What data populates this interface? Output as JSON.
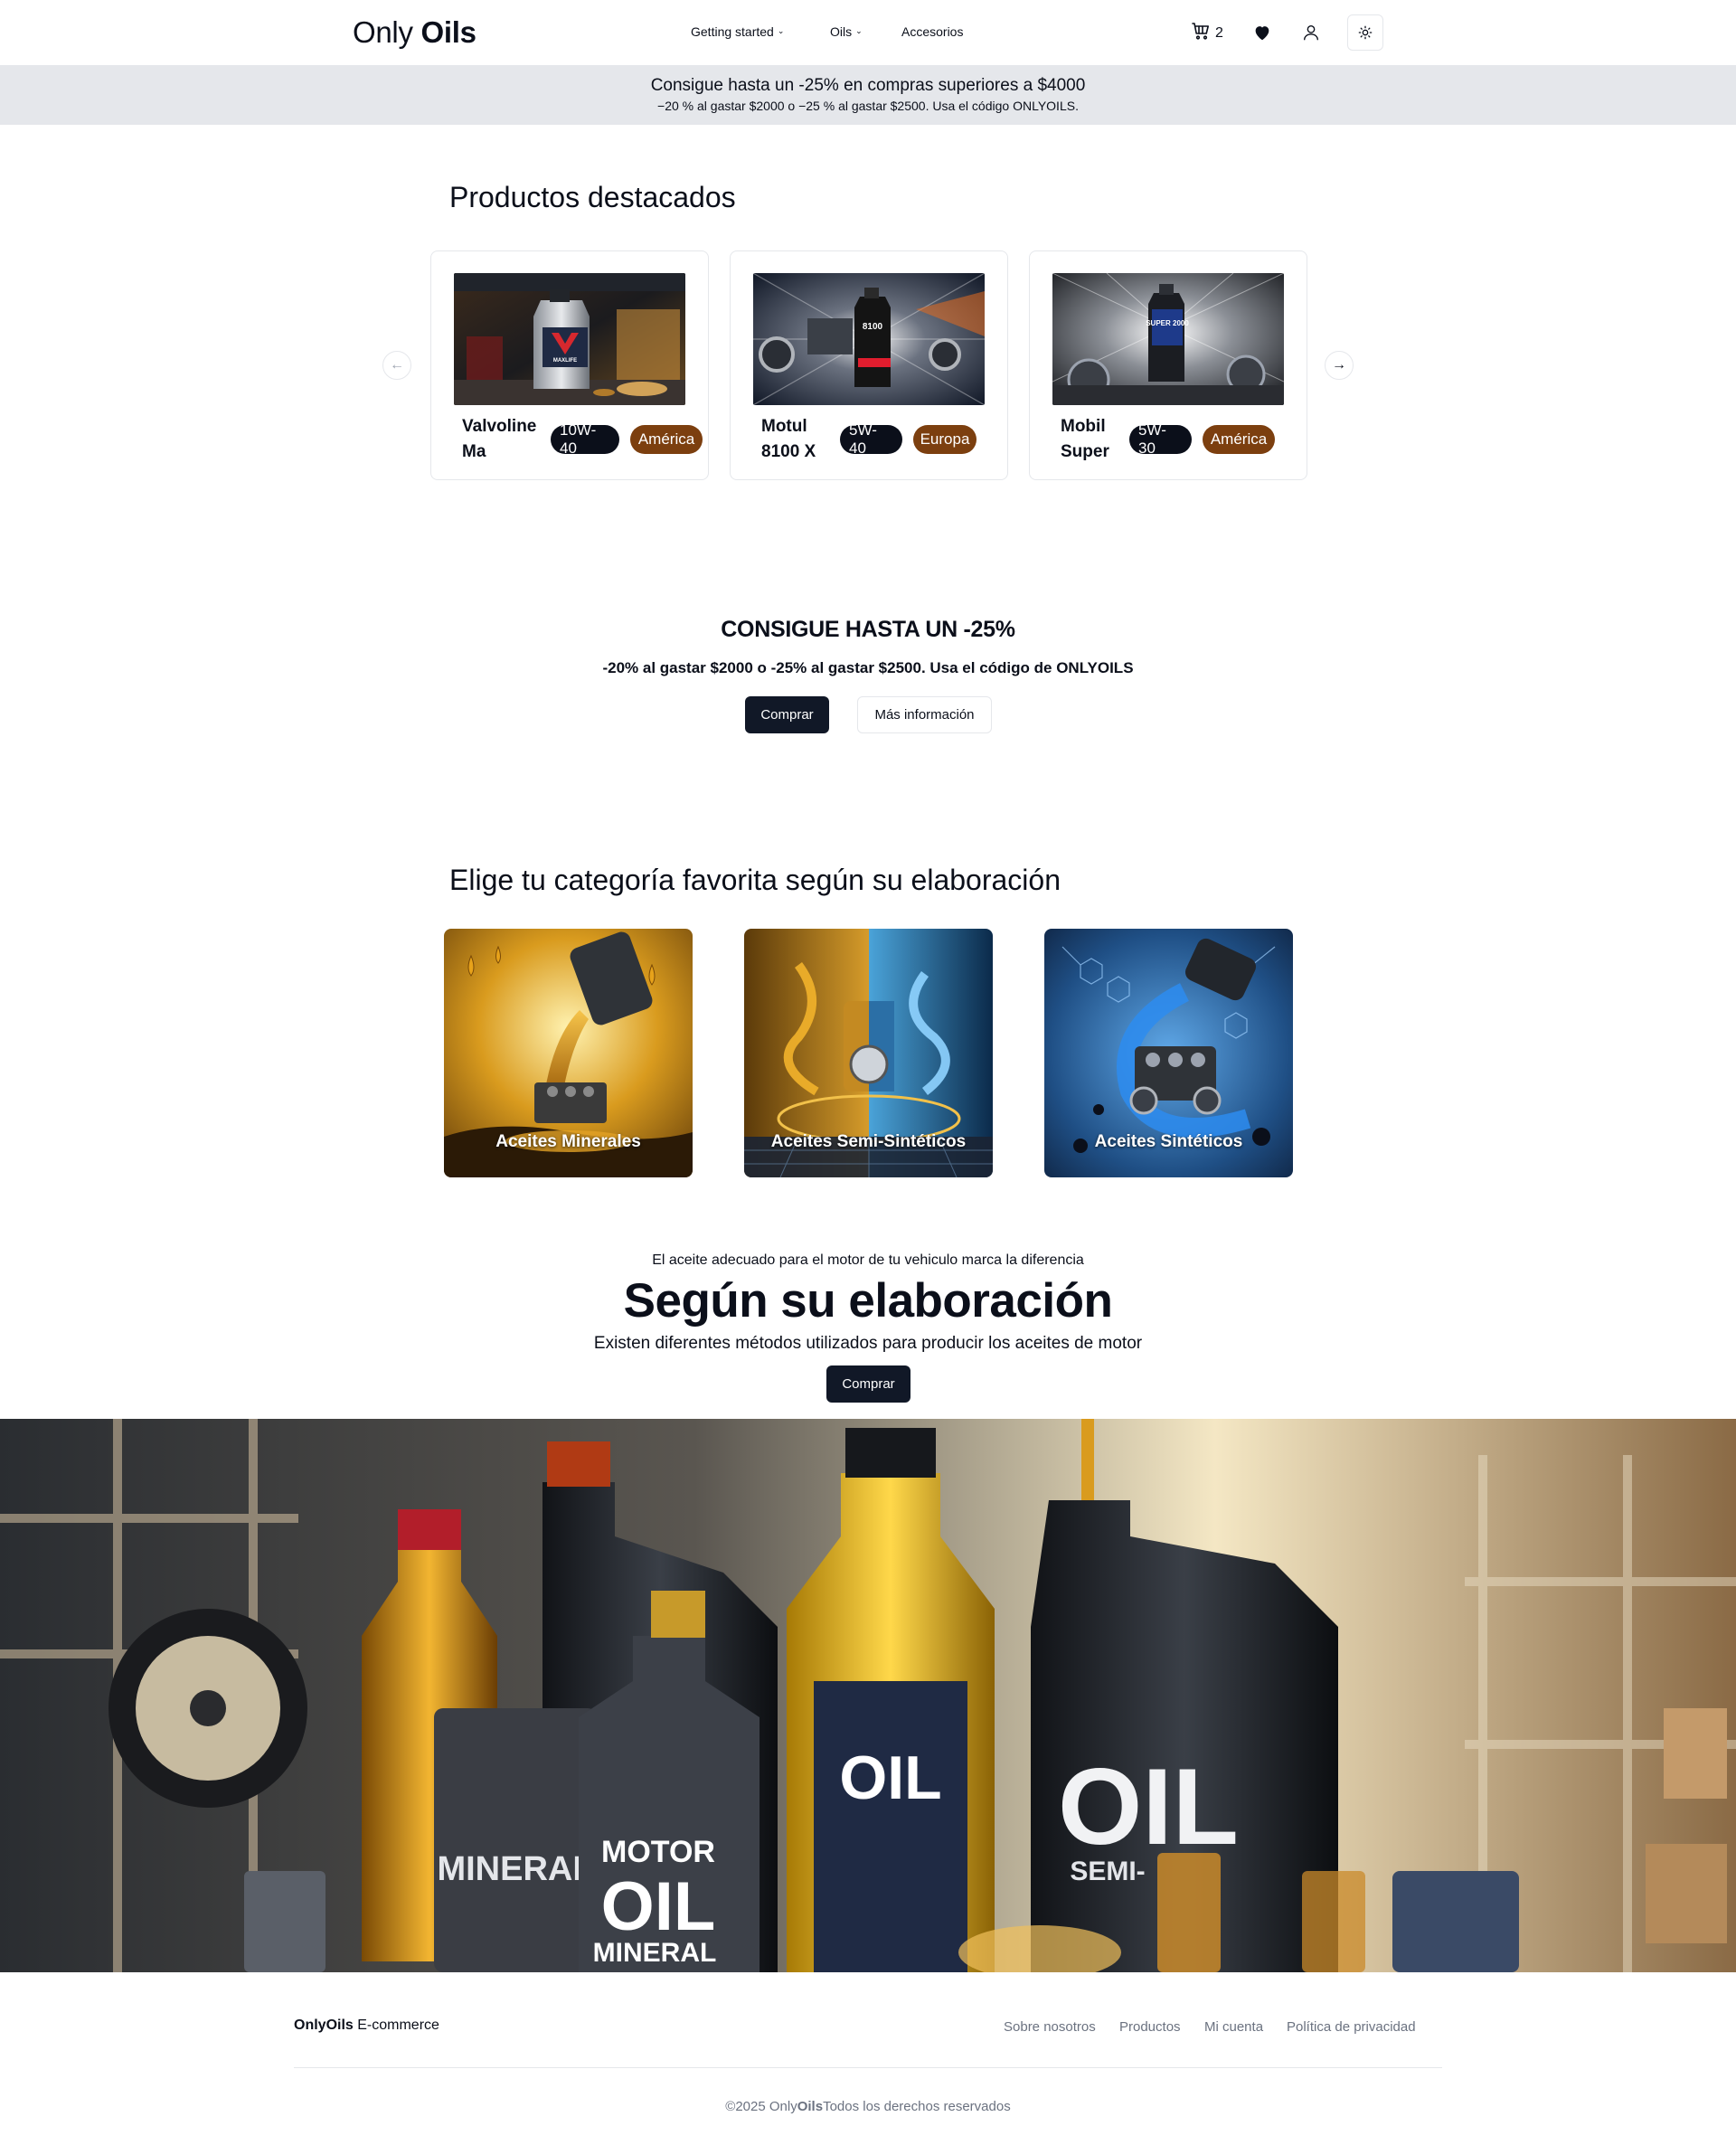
{
  "header": {
    "logo_light": "Only",
    "logo_bold": "Oils",
    "nav": {
      "getting_started": "Getting started",
      "oils": "Oils",
      "accesorios": "Accesorios"
    },
    "cart_count": "2",
    "icons": [
      "cart-icon",
      "heart-icon",
      "user-icon",
      "sun-icon"
    ]
  },
  "banner": {
    "headline": "Consigue hasta un -25% en compras superiores a $4000",
    "detail": "−20 % al gastar $2000 o −25 % al gastar $2500. Usa el código ONLYOILS."
  },
  "featured": {
    "title": "Productos destacados",
    "products": [
      {
        "name": "Valvoline Ma",
        "viscosity": "10W-40",
        "region": "América",
        "image_text": "MAXLIFE"
      },
      {
        "name": "Motul 8100 X",
        "viscosity": "5W-40",
        "region": "Europa",
        "image_text": "8100"
      },
      {
        "name": "Mobil Super",
        "viscosity": "5W-30",
        "region": "América",
        "image_text": "SUPER 2000"
      }
    ]
  },
  "promo": {
    "headline": "CONSIGUE HASTA UN -25%",
    "detail": "-20% al gastar $2000 o -25% al gastar $2500. Usa el código de ONLYOILS",
    "buy_label": "Comprar",
    "info_label": "Más información"
  },
  "categories": {
    "title": "Elige tu categoría favorita según su elaboración",
    "items": [
      {
        "label": "Aceites Minerales"
      },
      {
        "label": "Aceites Semi-Sintéticos"
      },
      {
        "label": "Aceites Sintéticos"
      }
    ]
  },
  "hero": {
    "kicker": "El aceite adecuado para el motor de tu vehiculo marca la diferencia",
    "title": "Según su elaboración",
    "description": "Existen diferentes métodos utilizados para producir los aceites de motor",
    "buy_label": "Comprar",
    "image_texts": [
      "MINERAL",
      "MOTOR",
      "OIL",
      "MINERAL",
      "OIL",
      "OIL",
      "SEMI-"
    ]
  },
  "footer": {
    "brand_bold": "Only",
    "brand_bold2": "Oils",
    "brand_rest": "E-commerce",
    "links": [
      "Sobre nosotros",
      "Productos",
      "Mi cuenta",
      "Política de privacidad"
    ],
    "copy_prefix": "©2025 Only",
    "copy_bold": "Oils",
    "copy_suffix": "Todos los derechos reservados"
  },
  "colors": {
    "brand_dark": "#111827",
    "region_pill": "#7c3f0f",
    "banner_bg": "#e5e7eb",
    "muted_text": "#6b7280"
  }
}
